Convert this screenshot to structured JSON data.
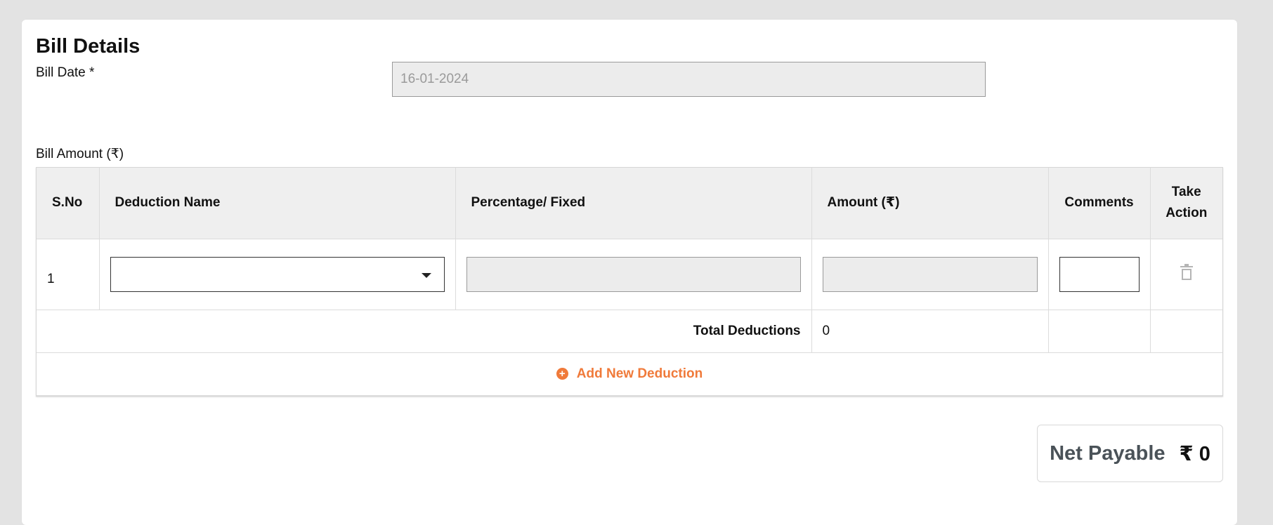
{
  "form": {
    "title": "Bill Details",
    "bill_date_label": "Bill Date *",
    "bill_date_value": "16-01-2024",
    "bill_amount_label": "Bill Amount (₹)"
  },
  "table": {
    "columns": [
      "S.No",
      "Deduction Name",
      "Percentage/ Fixed",
      "Amount (₹)",
      "Comments",
      "Take\nAction"
    ],
    "rows": [
      {
        "sno": "1",
        "deduction_name": "",
        "percentage_fixed": "",
        "amount": "",
        "comments": ""
      }
    ],
    "total_label": "Total Deductions",
    "total_value": "0",
    "add_label": "Add New Deduction"
  },
  "summary": {
    "net_payable_label": "Net Payable",
    "net_payable_value": "₹ 0"
  },
  "colors": {
    "accent": "#f07a3a",
    "header_bg": "#efefef",
    "disabled_bg": "#ececec",
    "page_bg": "#e3e3e3"
  },
  "icons": {
    "add": "plus-circle-icon",
    "delete": "trash-icon",
    "select": "caret-down-icon"
  }
}
